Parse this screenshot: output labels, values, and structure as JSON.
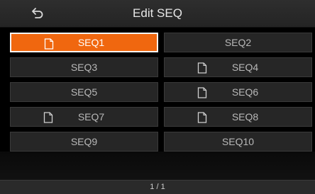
{
  "header": {
    "title": "Edit SEQ",
    "back_icon": "back-arrow-icon"
  },
  "accent_color": "#f0670f",
  "cells": [
    {
      "label": "SEQ1",
      "has_file": true,
      "selected": true
    },
    {
      "label": "SEQ2",
      "has_file": false,
      "selected": false
    },
    {
      "label": "SEQ3",
      "has_file": false,
      "selected": false
    },
    {
      "label": "SEQ4",
      "has_file": true,
      "selected": false
    },
    {
      "label": "SEQ5",
      "has_file": false,
      "selected": false
    },
    {
      "label": "SEQ6",
      "has_file": true,
      "selected": false
    },
    {
      "label": "SEQ7",
      "has_file": true,
      "selected": false
    },
    {
      "label": "SEQ8",
      "has_file": true,
      "selected": false
    },
    {
      "label": "SEQ9",
      "has_file": false,
      "selected": false
    },
    {
      "label": "SEQ10",
      "has_file": false,
      "selected": false
    }
  ],
  "footer": {
    "page_indicator": "1 / 1"
  }
}
